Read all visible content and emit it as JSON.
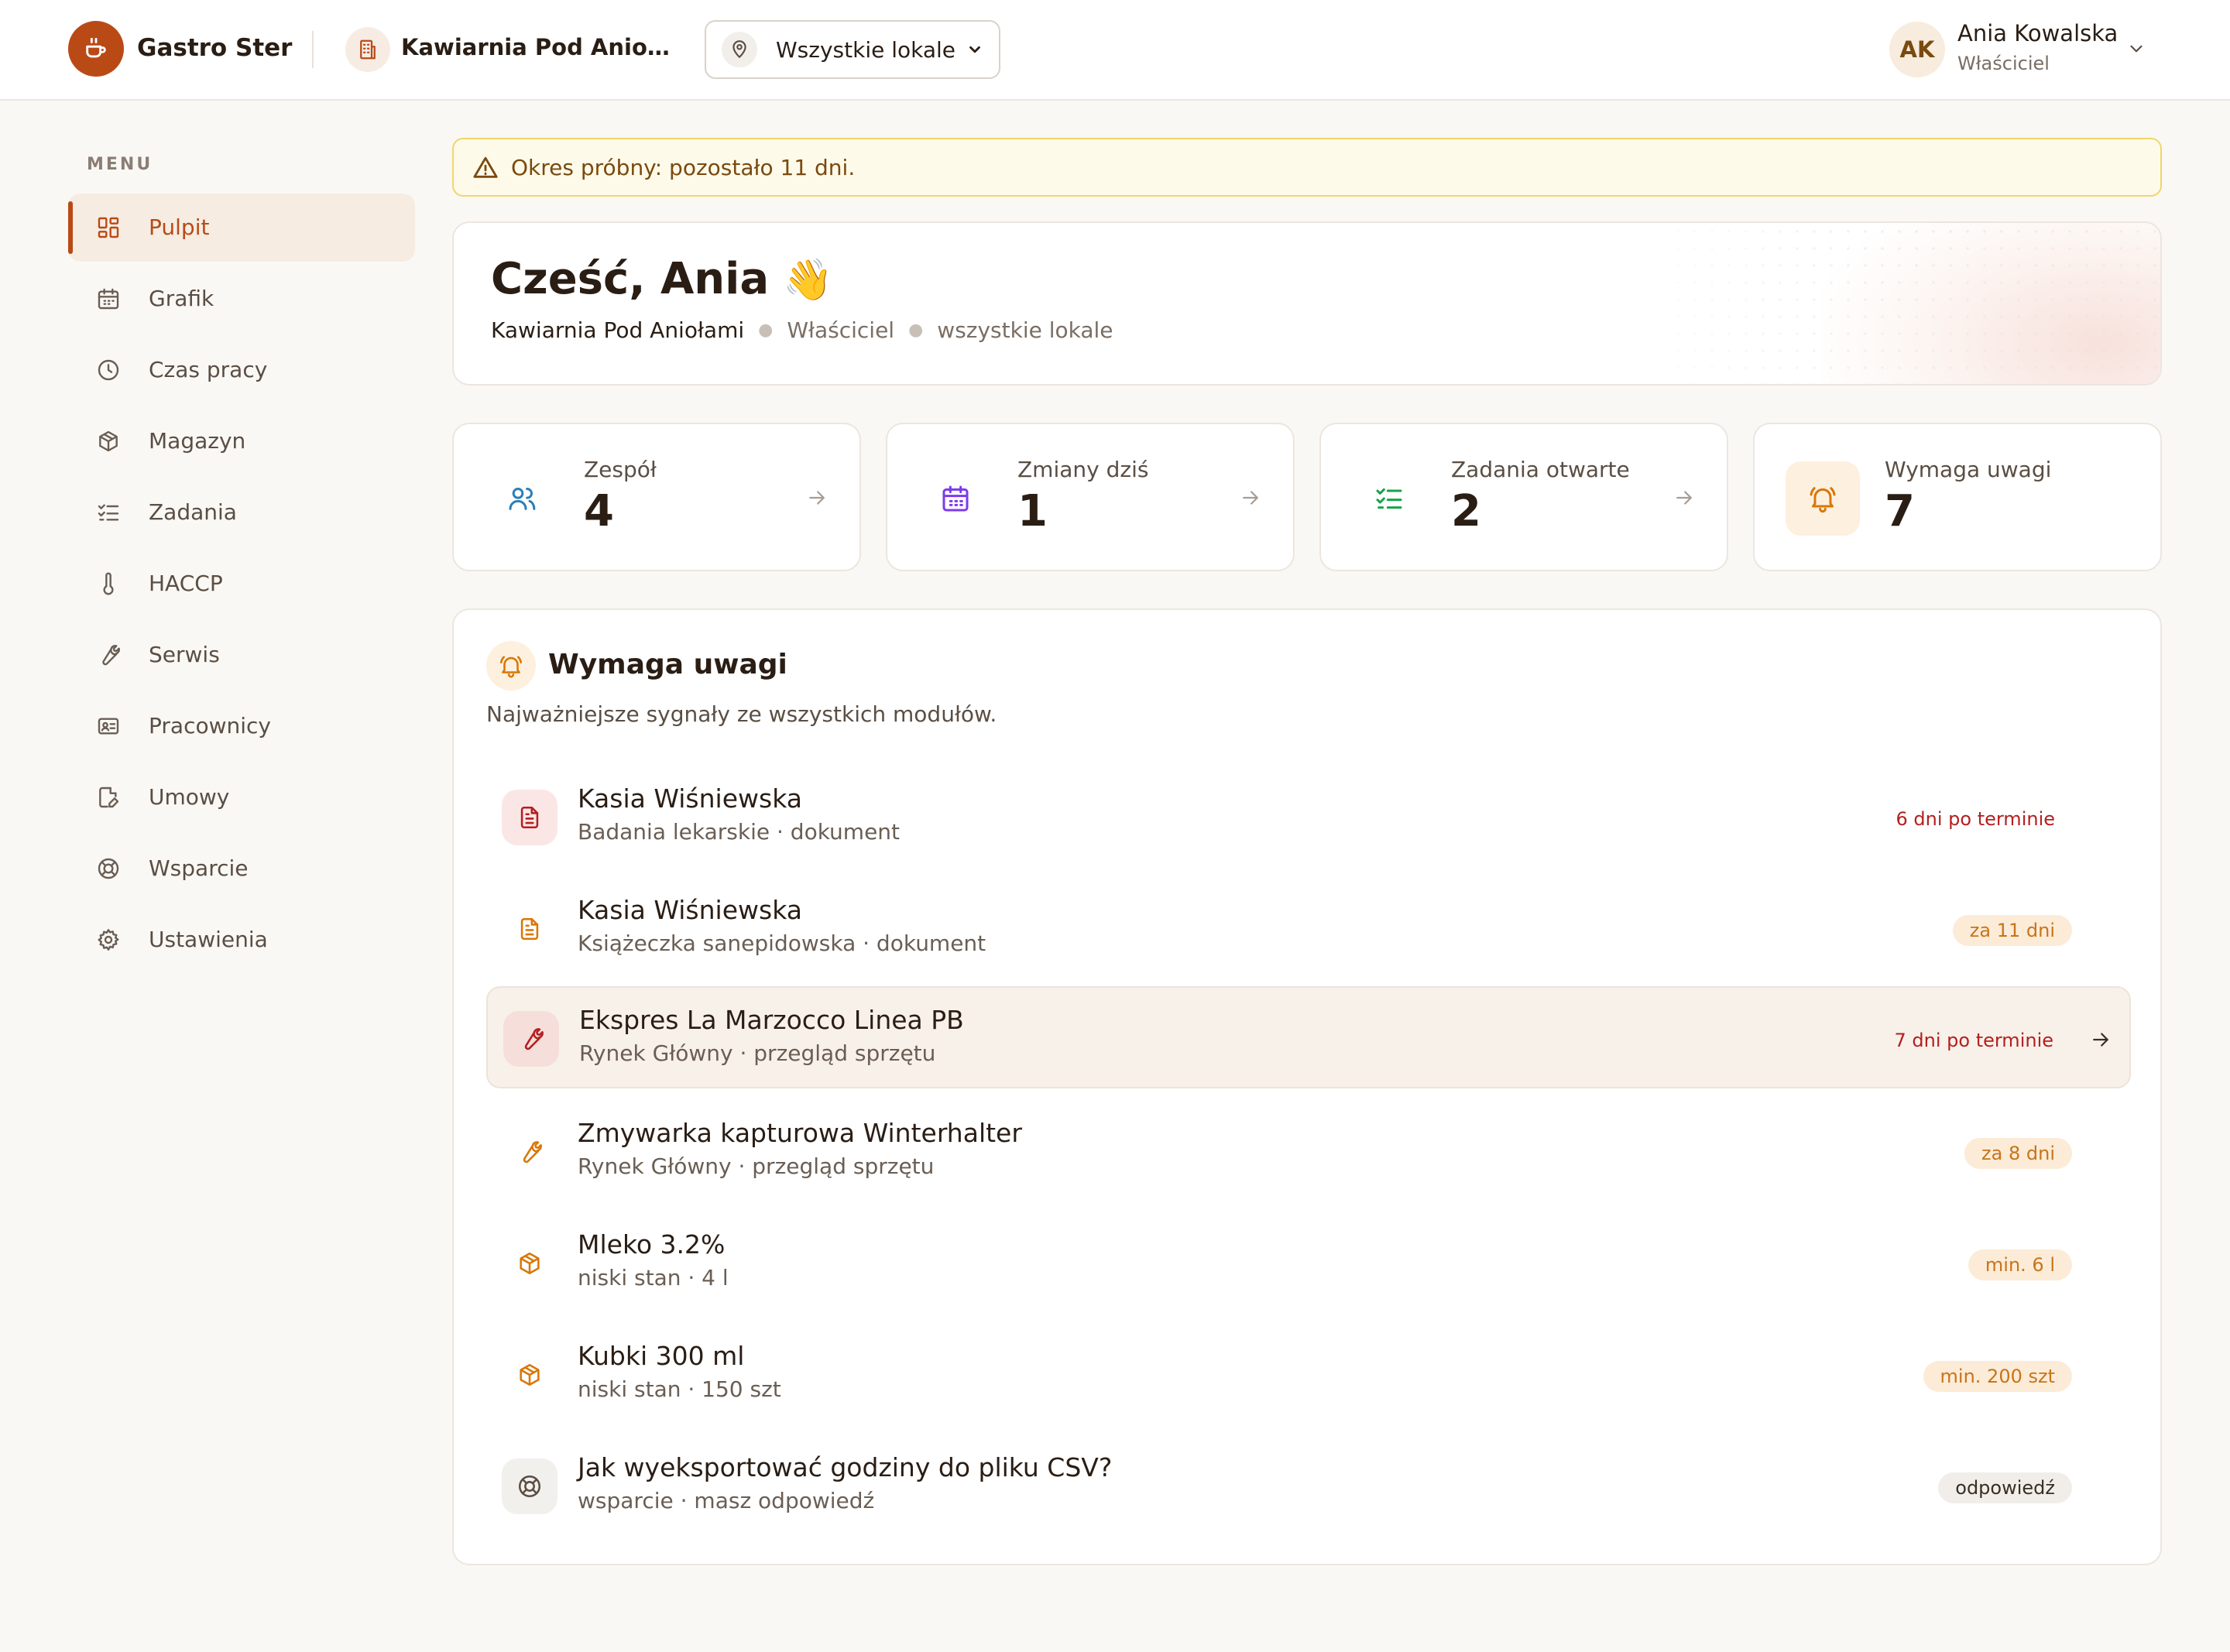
{
  "header": {
    "brand": "Gastro Ster",
    "business_name": "Kawiarnia Pod Aniołami",
    "location_select": "Wszystkie lokale",
    "user_initials": "AK",
    "user_name": "Ania Kowalska",
    "user_role": "Właściciel"
  },
  "sidebar": {
    "title": "MENU",
    "items": [
      {
        "label": "Pulpit",
        "icon": "dashboard-icon",
        "active": true
      },
      {
        "label": "Grafik",
        "icon": "calendar-icon"
      },
      {
        "label": "Czas pracy",
        "icon": "clock-icon"
      },
      {
        "label": "Magazyn",
        "icon": "box-icon"
      },
      {
        "label": "Zadania",
        "icon": "checklist-icon"
      },
      {
        "label": "HACCP",
        "icon": "thermometer-icon"
      },
      {
        "label": "Serwis",
        "icon": "wrench-icon"
      },
      {
        "label": "Pracownicy",
        "icon": "id-card-icon"
      },
      {
        "label": "Umowy",
        "icon": "document-edit-icon"
      },
      {
        "label": "Wsparcie",
        "icon": "lifebuoy-icon"
      },
      {
        "label": "Ustawienia",
        "icon": "gear-icon"
      }
    ]
  },
  "trial": {
    "text": "Okres próbny: pozostało 11 dni."
  },
  "greeting": {
    "title": "Cześć, Ania",
    "emoji": "👋",
    "business": "Kawiarnia Pod Aniołami",
    "role": "Właściciel",
    "scope": "wszystkie lokale"
  },
  "stats": [
    {
      "label": "Zespół",
      "value": "4",
      "icon": "users-icon",
      "color": "#2B7FB8"
    },
    {
      "label": "Zmiany dziś",
      "value": "1",
      "icon": "calendar-icon",
      "color": "#7C3AED"
    },
    {
      "label": "Zadania otwarte",
      "value": "2",
      "icon": "checklist-icon",
      "color": "#16A34A"
    },
    {
      "label": "Wymaga uwagi",
      "value": "7",
      "icon": "bell-icon",
      "color": "#D97706"
    }
  ],
  "attention": {
    "title": "Wymaga uwagi",
    "subtitle": "Najważniejsze sygnały ze wszystkich modułów.",
    "items": [
      {
        "title": "Kasia Wiśniewska",
        "sub": "Badania lekarskie · dokument",
        "badge": "6 dni po terminie",
        "status": "overdue",
        "icon": "document-icon"
      },
      {
        "title": "Kasia Wiśniewska",
        "sub": "Książeczka sanepidowska · dokument",
        "badge": "za 11 dni",
        "status": "warn",
        "icon": "document-icon"
      },
      {
        "title": "Ekspres La Marzocco Linea PB",
        "sub": "Rynek Główny · przegląd sprzętu",
        "badge": "7 dni po terminie",
        "status": "overdue",
        "icon": "wrench-icon"
      },
      {
        "title": "Zmywarka kapturowa Winterhalter",
        "sub": "Rynek Główny · przegląd sprzętu",
        "badge": "za 8 dni",
        "status": "warn",
        "icon": "wrench-icon"
      },
      {
        "title": "Mleko 3.2%",
        "sub": "niski stan · 4 l",
        "badge": "min. 6 l",
        "status": "warn",
        "icon": "box-icon"
      },
      {
        "title": "Kubki 300 ml",
        "sub": "niski stan · 150 szt",
        "badge": "min. 200 szt",
        "status": "warn",
        "icon": "box-icon"
      },
      {
        "title": "Jak wyeksportować godziny do pliku CSV?",
        "sub": "wsparcie · masz odpowiedź",
        "badge": "odpowiedź",
        "status": "neutral",
        "icon": "lifebuoy-icon"
      }
    ]
  },
  "colors": {
    "brand": "#B94A16",
    "overdue": "#B32020",
    "warning": "#C7751A",
    "background": "#FAF8F4"
  }
}
